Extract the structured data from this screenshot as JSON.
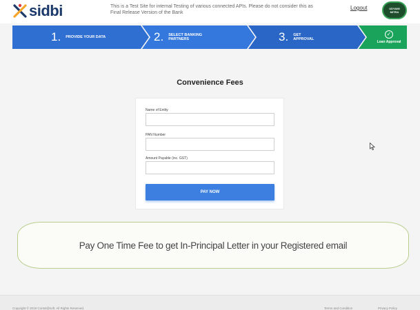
{
  "header": {
    "logo_text": "sidbi",
    "notice": "This is a Test Site for internal Testing of various connected APIs. Please do not consider this as Final Release Version of the Bank",
    "logout_label": "Logout",
    "badge_text": "UDYAMI MITRA"
  },
  "stepper": {
    "steps": [
      {
        "number": "1.",
        "label": "PROVIDE YOUR DATA"
      },
      {
        "number": "2.",
        "label": "SELECT BANKING PARTNERS"
      },
      {
        "number": "3.",
        "label": "GET APPROVAL"
      }
    ],
    "final_label": "Loan Approval",
    "colors": {
      "blue": "#2f6fd1",
      "green": "#1aa35a"
    }
  },
  "form": {
    "title": "Convenience Fees",
    "fields": [
      {
        "label": "Name of Entity",
        "value": ""
      },
      {
        "label": "PAN Number",
        "value": ""
      },
      {
        "label": "Amount Payable (inc. GST)",
        "value": ""
      }
    ],
    "submit_label": "PAY NOW"
  },
  "banner": {
    "text": "Pay One Time Fee to get In-Principal Letter in  your Registered email"
  },
  "footer": {
    "copyright": "Copyright © 2019 Contxt@soft. All Rights Reserved.",
    "terms": "Terms and Condition",
    "privacy": "Privacy Policy"
  }
}
